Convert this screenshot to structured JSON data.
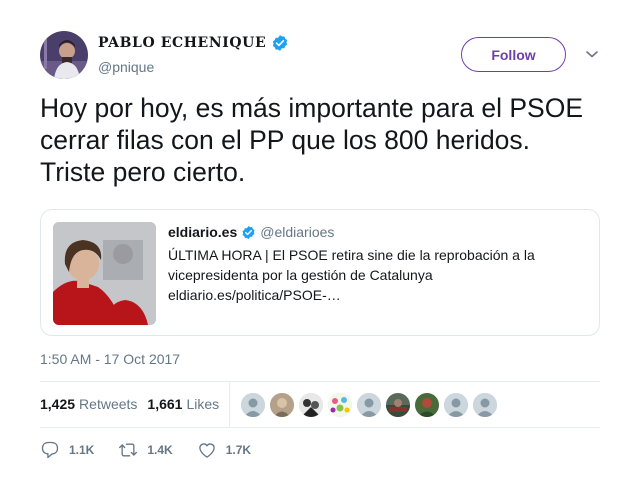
{
  "author": {
    "name": "PABLO ECHENIQUE",
    "handle": "@pnique",
    "verified": true
  },
  "follow_label": "Follow",
  "tweet_text": "Hoy por hoy, es más importante para el PSOE cerrar filas con el PP que los 800 heridos. Triste pero cierto.",
  "quoted": {
    "name": "eldiario.es",
    "handle": "@eldiarioes",
    "text": "ÚLTIMA HORA | El PSOE retira sine die la reprobación a la vicepresidenta por la gestión de Catalunya eldiario.es/politica/PSOE-…"
  },
  "timestamp": "1:50 AM - 17 Oct 2017",
  "stats": {
    "retweets_count": "1,425",
    "retweets_label": "Retweets",
    "likes_count": "1,661",
    "likes_label": "Likes"
  },
  "actions": {
    "reply_count": "1.1K",
    "retweet_count": "1.4K",
    "like_count": "1.7K"
  },
  "colors": {
    "follow_purple": "#6f3fa8",
    "verified_blue": "#1da1f2",
    "secondary_text": "#657786"
  }
}
